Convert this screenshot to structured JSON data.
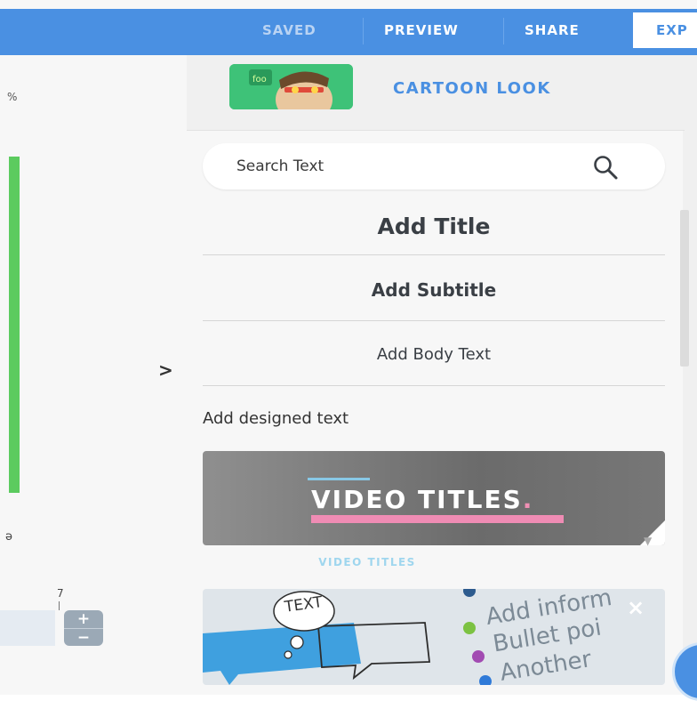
{
  "topbar": {
    "saved_label": "SAVED",
    "preview_label": "PREVIEW",
    "share_label": "SHARE",
    "export_label": "EXP"
  },
  "left": {
    "percent_glyph": "%",
    "ruler_value": "7",
    "side_glyph": "ə",
    "zoom_plus": "+",
    "zoom_minus": "−",
    "collapse_glyph": ">"
  },
  "panel": {
    "cartoon_label": "CARTOON LOOK",
    "search": {
      "placeholder": "Search Text",
      "value": ""
    },
    "add_title": "Add Title",
    "add_subtitle": "Add Subtitle",
    "add_body": "Add Body Text",
    "designed_heading": "Add designed text",
    "card1": {
      "title": "VIDEO TITLES",
      "title_dot": ".",
      "caption": "VIDEO TITLES"
    },
    "card2": {
      "bubble_text": "TEXT",
      "bullets": [
        "Add inform",
        "Bullet poi",
        "Another"
      ],
      "close": "×"
    }
  },
  "colors": {
    "brand_blue": "#4a90e2",
    "green": "#5ccb5f",
    "pink": "#ef8cb4",
    "light_blue": "#9fd6ee"
  },
  "icons": [
    "search-icon",
    "chevron-right-icon",
    "close-icon",
    "speech-bubble-icon",
    "thought-bubble-icon"
  ]
}
